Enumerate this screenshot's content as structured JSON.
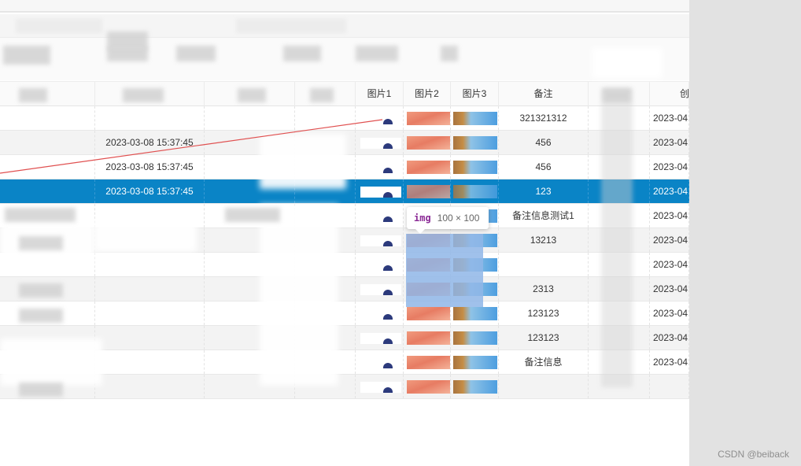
{
  "table": {
    "headers": [
      "图片1",
      "图片2",
      "图片3",
      "备注",
      "创"
    ],
    "rows": [
      {
        "time": "",
        "remark": "321321312",
        "created": "2023-04"
      },
      {
        "time": "2023-03-08 15:37:45",
        "remark": "456",
        "created": "2023-04"
      },
      {
        "time": "2023-03-08 15:37:45",
        "remark": "456",
        "created": "2023-04"
      },
      {
        "time": "2023-03-08 15:37:45",
        "remark": "123",
        "created": "2023-04"
      },
      {
        "time": "",
        "remark": "备注信息测试1",
        "created": "2023-04"
      },
      {
        "time": "",
        "remark": "13213",
        "created": "2023-04"
      },
      {
        "time": "",
        "remark": "",
        "created": "2023-04"
      },
      {
        "time": "",
        "remark": "2313",
        "created": "2023-04"
      },
      {
        "time": "",
        "remark": "123123",
        "created": "2023-04"
      },
      {
        "time": "",
        "remark": "123123",
        "created": "2023-04"
      },
      {
        "time": "",
        "remark": "备注信息",
        "created": "2023-04"
      },
      {
        "time": "",
        "remark": "",
        "created": ""
      }
    ],
    "selected_row": 3
  },
  "tooltip": {
    "tag": "img",
    "size": "100 × 100"
  },
  "watermark": "CSDN @beiback",
  "colors": {
    "selected": "#0a84c6",
    "tooltip_tag": "#8b2b96",
    "annotation_line": "#e05050"
  }
}
